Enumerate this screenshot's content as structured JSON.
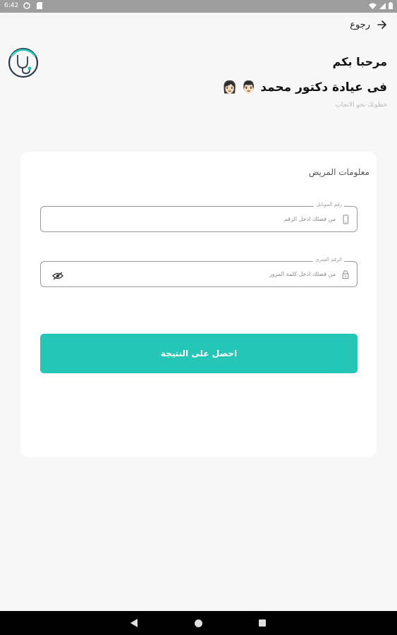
{
  "status_bar": {
    "time": "6:42",
    "left_icons": [
      "sync-icon",
      "sd-card-icon"
    ],
    "right_icons": [
      "wifi-icon",
      "signal-icon",
      "battery-icon"
    ]
  },
  "header": {
    "back_label": "رجوع",
    "back_icon": "arrow-right-icon"
  },
  "intro": {
    "welcome": "مرحبا بكم",
    "clinic": "فى عيادة دكتور محمد 👨🏻 👩🏻",
    "tagline": "خطوتك نحو الانجاب"
  },
  "form": {
    "title": "معلومات المريض",
    "mobile": {
      "label": "رقم الموبايل",
      "placeholder": "من فضلك ادخل الرقم",
      "value": ""
    },
    "password": {
      "label": "الرقم السري",
      "placeholder": "من فضلك ادخل كلمة المرور",
      "value": ""
    },
    "submit_label": "احصل على النتيجة"
  },
  "colors": {
    "accent": "#26c6b6",
    "background": "#f7f7f7",
    "card": "#ffffff"
  },
  "nav_bar": {
    "icons": [
      "nav-back-icon",
      "nav-home-icon",
      "nav-recent-icon"
    ]
  }
}
